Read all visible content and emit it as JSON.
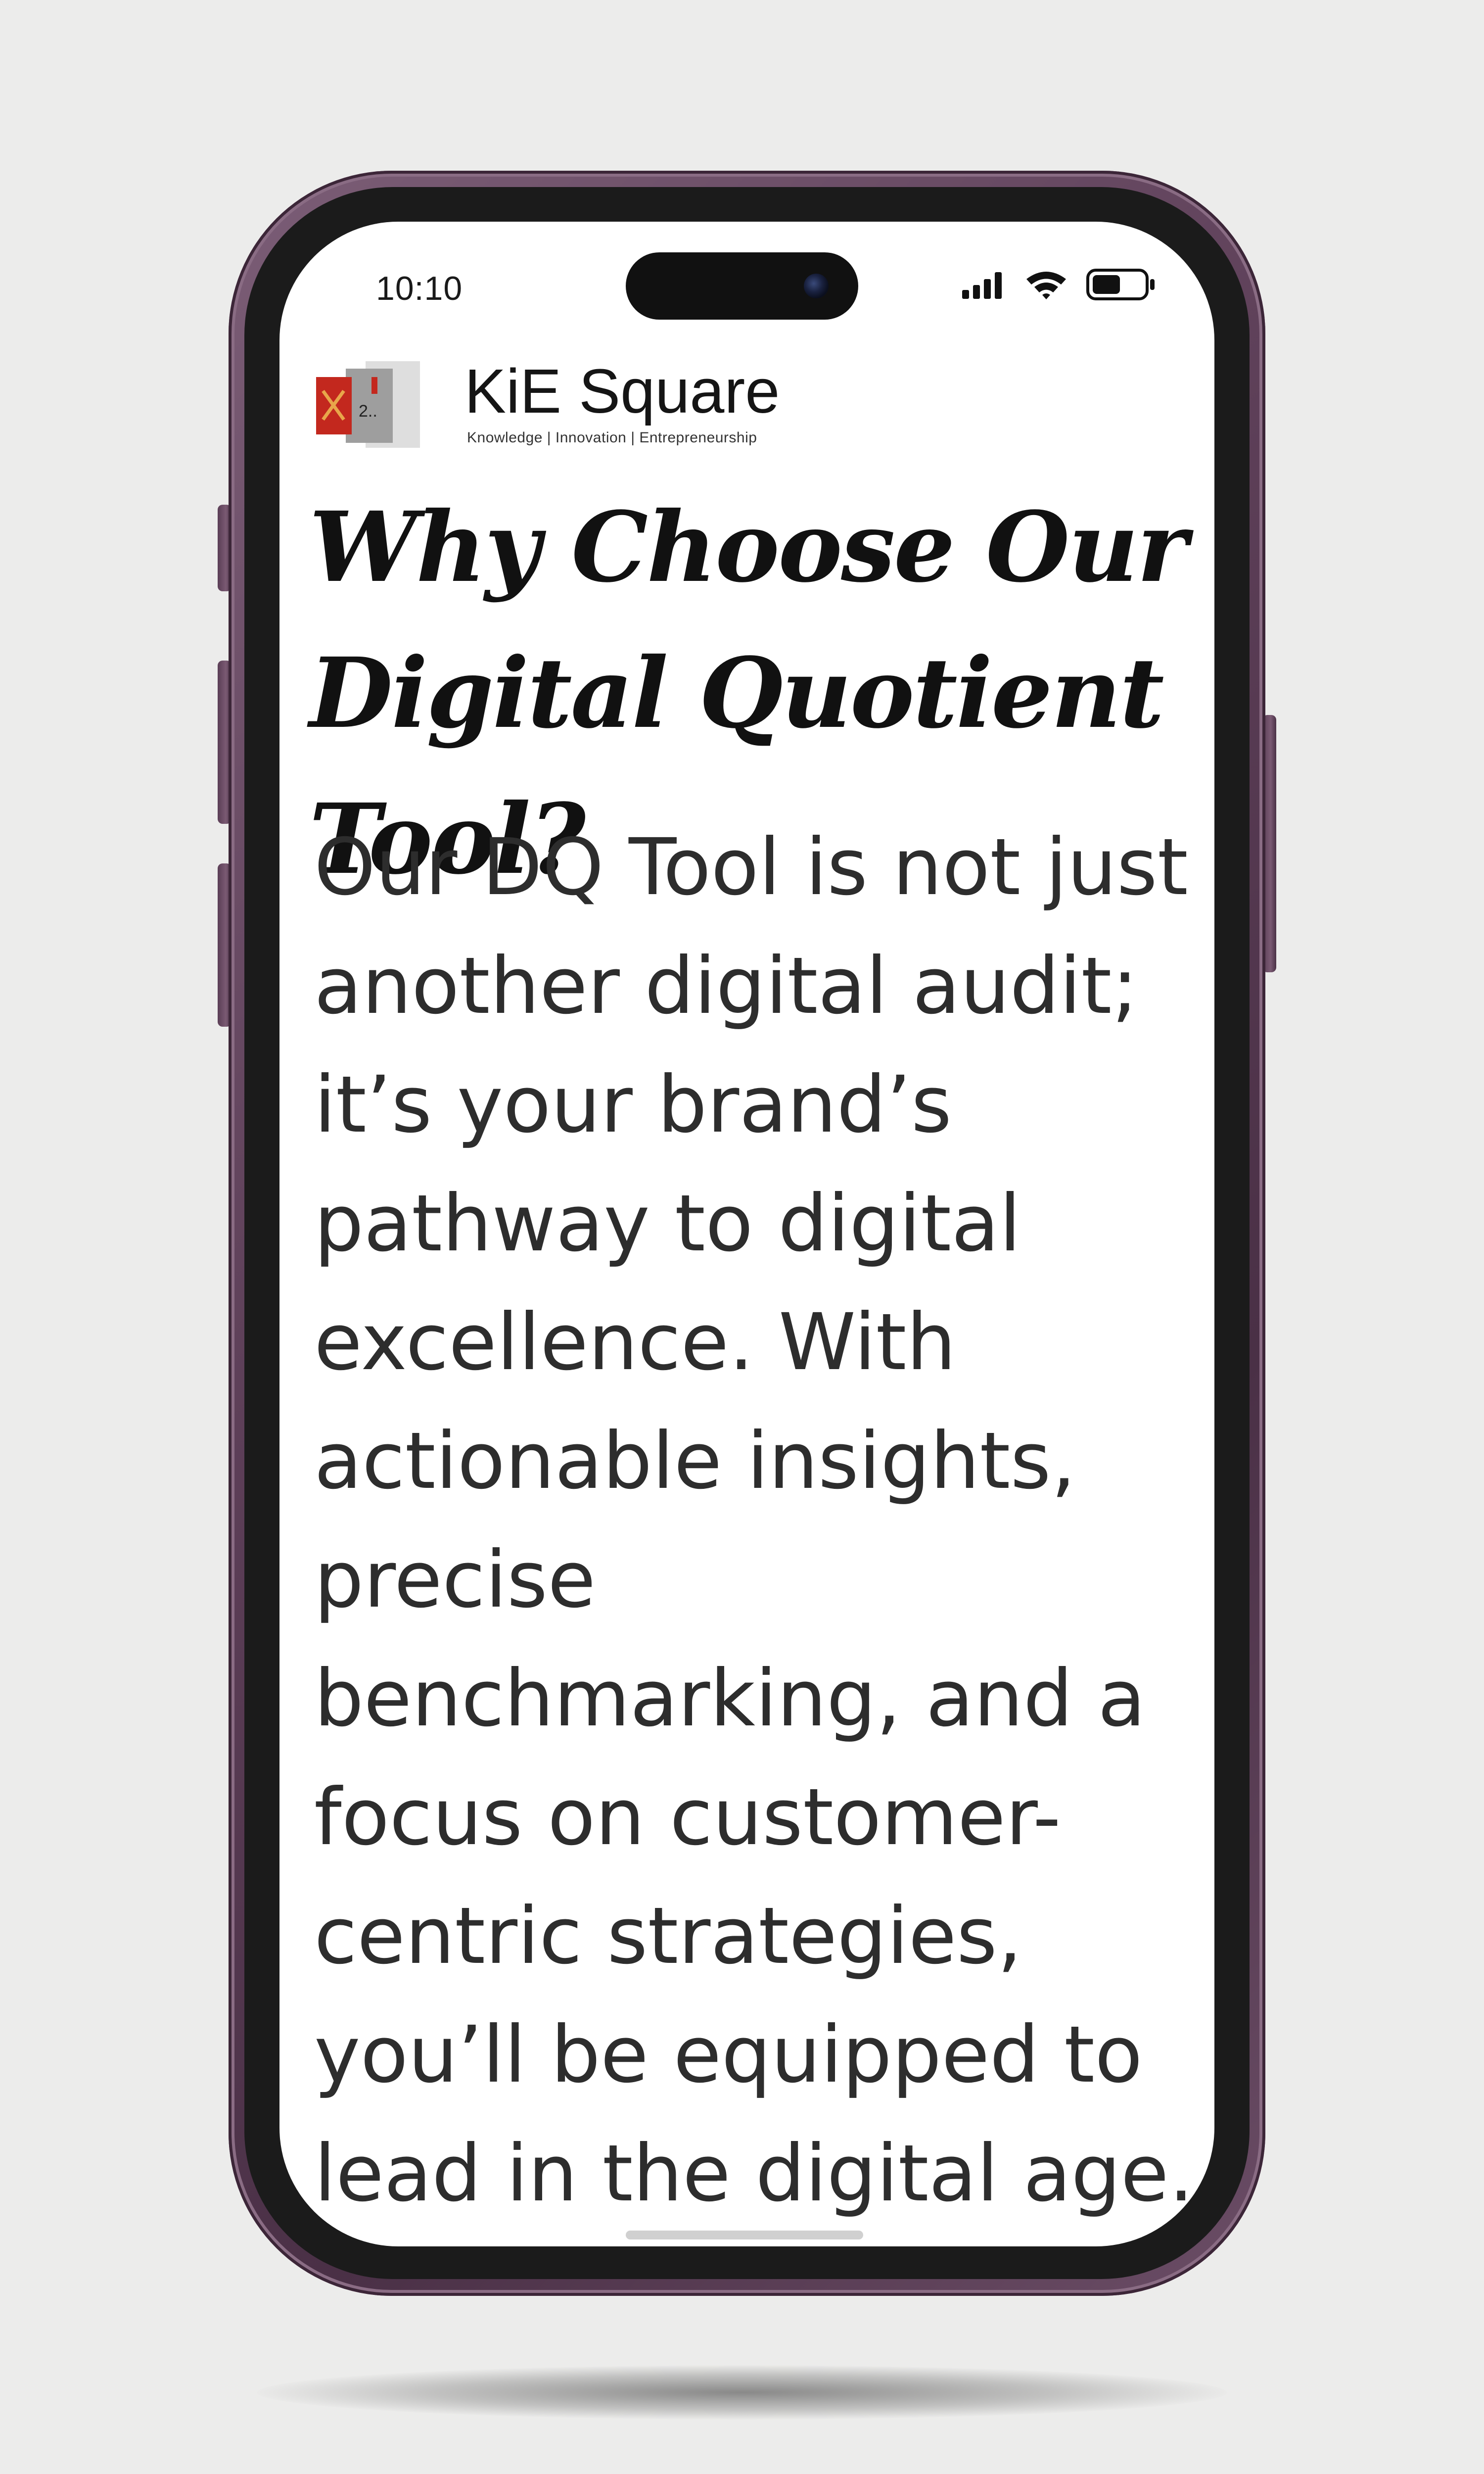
{
  "status_bar": {
    "time": "10:10",
    "icons": [
      "signal-icon",
      "wifi-icon",
      "battery-icon"
    ],
    "battery_level": 0.55
  },
  "brand": {
    "name": "KiE Square",
    "tagline": "Knowledge | Innovation | Entrepreneurship"
  },
  "content": {
    "headline": "Why Choose Our Digital Quotient Tool?",
    "body": "Our DQ Tool is not just another digital audit; it’s your brand’s pathway to digital excellence. With actionable insights, precise benchmarking, and a focus on customer-centric strategies, you’ll be equipped to lead in the digital age."
  },
  "colors": {
    "phone_frame": "#5d3f58",
    "bezel": "#1b1b1b",
    "background": "#ececeb",
    "logo_red": "#c3281e"
  }
}
